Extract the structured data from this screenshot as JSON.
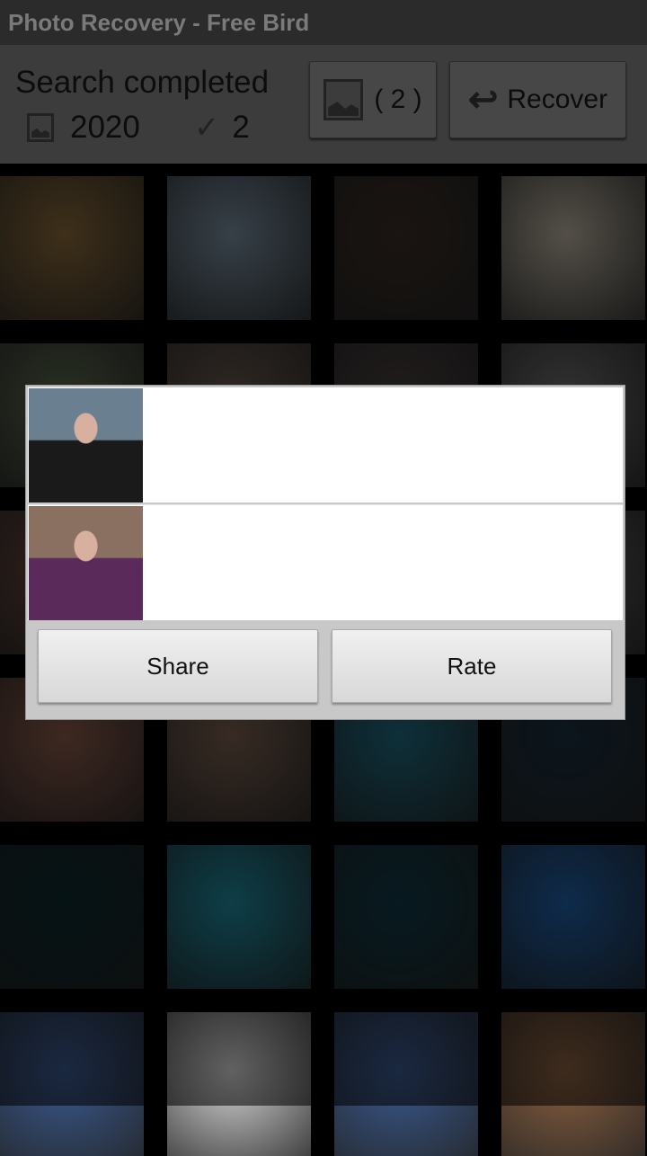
{
  "app": {
    "title": "Photo Recovery - Free Bird"
  },
  "header": {
    "status": "Search completed",
    "found_count": "2020",
    "selected_count": "2",
    "selected_button_label": "( 2 )",
    "recover_label": "Recover"
  },
  "grid": {
    "tiles": [
      "#8a6a3a",
      "#7a8fa0",
      "#3a2e28",
      "#b9b0a0",
      "#5c6a50",
      "#6a5a50",
      "#4a4040",
      "#707070",
      "#6a4a40",
      "#5a5048",
      "#504848",
      "#606060",
      "#8a5a4a",
      "#7a6050",
      "#1f6a80",
      "#1a3040",
      "#0c2a30",
      "#1f8aa0",
      "#0f3a48",
      "#2060a8",
      "#3a5a90",
      "#d8d8d8",
      "#3a5a90",
      "#8a6040"
    ]
  },
  "dialog": {
    "items": [
      {
        "thumb_color": "#6a7f8f",
        "thumb_accent": "#1a1a1a"
      },
      {
        "thumb_color": "#8a7060",
        "thumb_accent": "#5a2a5a"
      }
    ],
    "share_label": "Share",
    "rate_label": "Rate"
  }
}
